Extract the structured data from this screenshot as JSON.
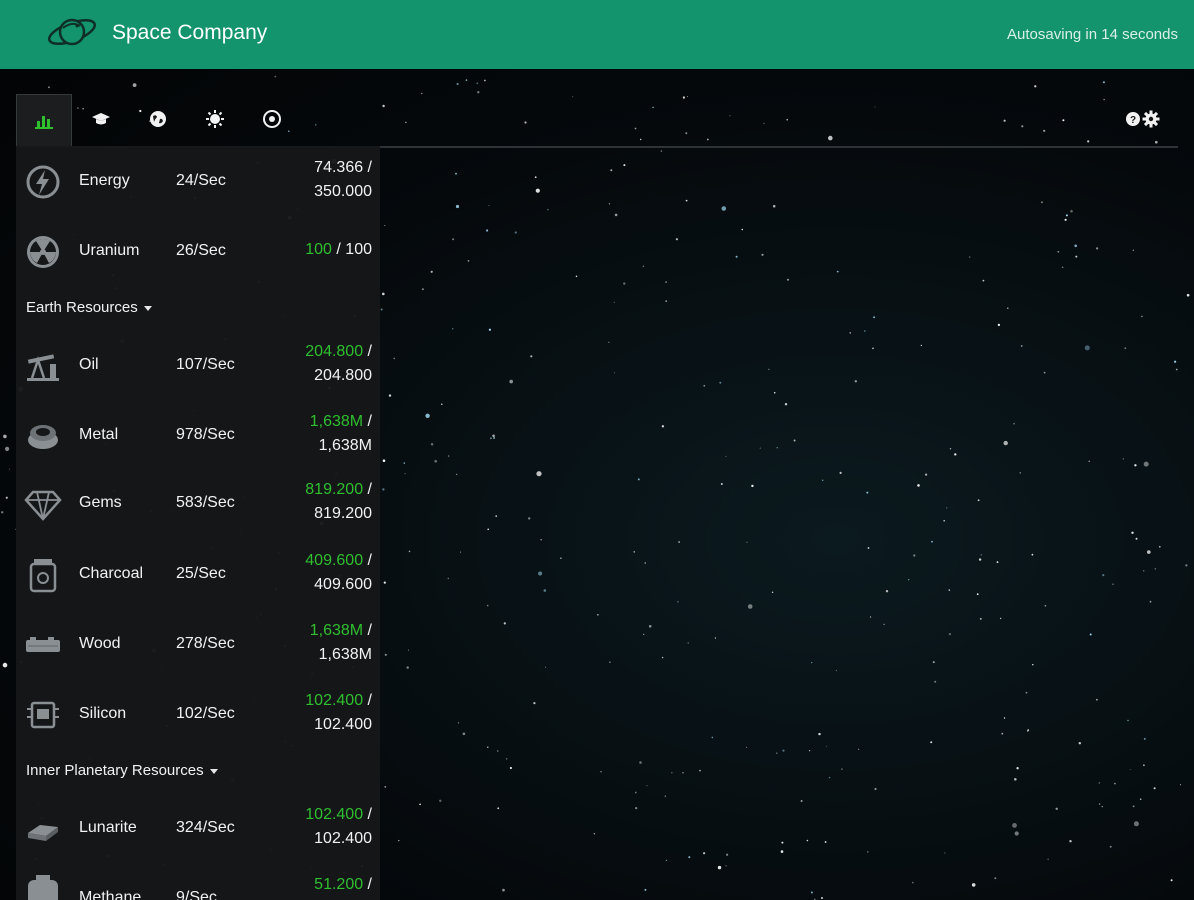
{
  "header": {
    "title": "Space Company",
    "autosave": "Autosaving in 14 seconds"
  },
  "tabs": [
    {
      "icon": "resources-bar-chart-icon",
      "active": true
    },
    {
      "icon": "research-graduation-cap-icon",
      "active": false
    },
    {
      "icon": "solar-system-globe-icon",
      "active": false
    },
    {
      "icon": "sun-icon",
      "active": false
    },
    {
      "icon": "target-icon",
      "active": false
    }
  ],
  "settings": {
    "icons": [
      "help-icon",
      "gear-icon"
    ]
  },
  "colors": {
    "header": "#13946d",
    "capped": "#2fbf2f",
    "panel": "#161719"
  },
  "resources": [
    {
      "name": "Energy",
      "rate": "24/Sec",
      "current": "74.366",
      "max": "350.000",
      "full": false,
      "icon": "energy-bolt-icon"
    },
    {
      "name": "Uranium",
      "rate": "26/Sec",
      "current": "100",
      "max": "100",
      "full": true,
      "icon": "radiation-icon"
    }
  ],
  "sections": [
    {
      "title": "Earth Resources",
      "items": [
        {
          "name": "Oil",
          "rate": "107/Sec",
          "current": "204.800",
          "max": "204.800",
          "full": true,
          "icon": "oil-pump-icon"
        },
        {
          "name": "Metal",
          "rate": "978/Sec",
          "current": "1,638M",
          "max": "1,638M",
          "full": true,
          "icon": "metal-ore-icon"
        },
        {
          "name": "Gems",
          "rate": "583/Sec",
          "current": "819.200",
          "max": "819.200",
          "full": true,
          "icon": "gem-icon"
        },
        {
          "name": "Charcoal",
          "rate": "25/Sec",
          "current": "409.600",
          "max": "409.600",
          "full": true,
          "icon": "charcoal-jar-icon"
        },
        {
          "name": "Wood",
          "rate": "278/Sec",
          "current": "1,638M",
          "max": "1,638M",
          "full": true,
          "icon": "wood-log-icon"
        },
        {
          "name": "Silicon",
          "rate": "102/Sec",
          "current": "102.400",
          "max": "102.400",
          "full": true,
          "icon": "silicon-chip-icon"
        }
      ]
    },
    {
      "title": "Inner Planetary Resources",
      "items": [
        {
          "name": "Lunarite",
          "rate": "324/Sec",
          "current": "102.400",
          "max": "102.400",
          "full": true,
          "icon": "lunarite-icon"
        },
        {
          "name": "Methane",
          "rate": "9/Sec",
          "current": "51.200",
          "max": "",
          "full": true,
          "icon": "methane-tank-icon"
        }
      ]
    }
  ]
}
